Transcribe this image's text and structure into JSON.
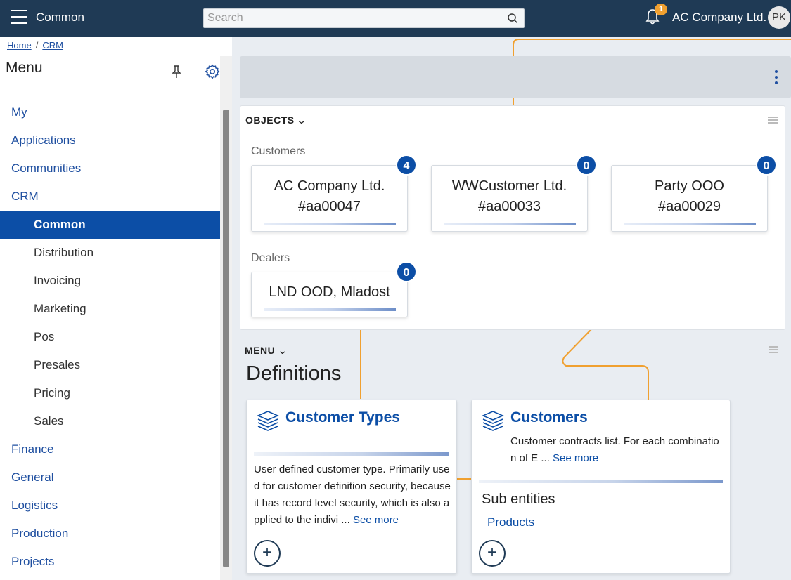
{
  "header": {
    "app_title": "Common",
    "search_placeholder": "Search",
    "notification_count": "1",
    "company": "AC Company Ltd.",
    "avatar_initials": "PK"
  },
  "breadcrumb": {
    "home": "Home",
    "separator": "/",
    "crm": "CRM"
  },
  "sidebar": {
    "title": "Menu",
    "items": [
      {
        "label": "My"
      },
      {
        "label": "Applications"
      },
      {
        "label": "Communities"
      },
      {
        "label": "CRM"
      },
      {
        "label": "Common"
      },
      {
        "label": "Distribution"
      },
      {
        "label": "Invoicing"
      },
      {
        "label": "Marketing"
      },
      {
        "label": "Pos"
      },
      {
        "label": "Presales"
      },
      {
        "label": "Pricing"
      },
      {
        "label": "Sales"
      },
      {
        "label": "Finance"
      },
      {
        "label": "General"
      },
      {
        "label": "Logistics"
      },
      {
        "label": "Production"
      },
      {
        "label": "Projects"
      }
    ]
  },
  "objects": {
    "heading": "OBJECTS",
    "customers_label": "Customers",
    "customers": [
      {
        "name": "AC Company Ltd.",
        "code": "#aa00047",
        "count": "4"
      },
      {
        "name": "WWCustomer Ltd.",
        "code": "#aa00033",
        "count": "0"
      },
      {
        "name": "Party OOO",
        "code": "#aa00029",
        "count": "0"
      }
    ],
    "dealers_label": "Dealers",
    "dealers": [
      {
        "name": "LND OOD, Mladost",
        "count": "0"
      }
    ]
  },
  "menu_section": {
    "heading": "MENU",
    "title": "Definitions",
    "cards": [
      {
        "title": "Customer Types",
        "description": "User defined customer type. Primarily used for customer definition security, because it has record level security, which is also applied to the indivi ...",
        "see_more": "See more"
      },
      {
        "title": "Customers",
        "description": "Customer contracts list. For each combination of E ...",
        "see_more": "See more",
        "sub_entities_title": "Sub entities",
        "sub_entities": [
          "Products"
        ]
      }
    ],
    "add_symbol": "+"
  },
  "colors": {
    "topbar": "#1f3a55",
    "accent": "#0c4ea6",
    "connector": "#f0a030",
    "badge": "#f0a030"
  }
}
